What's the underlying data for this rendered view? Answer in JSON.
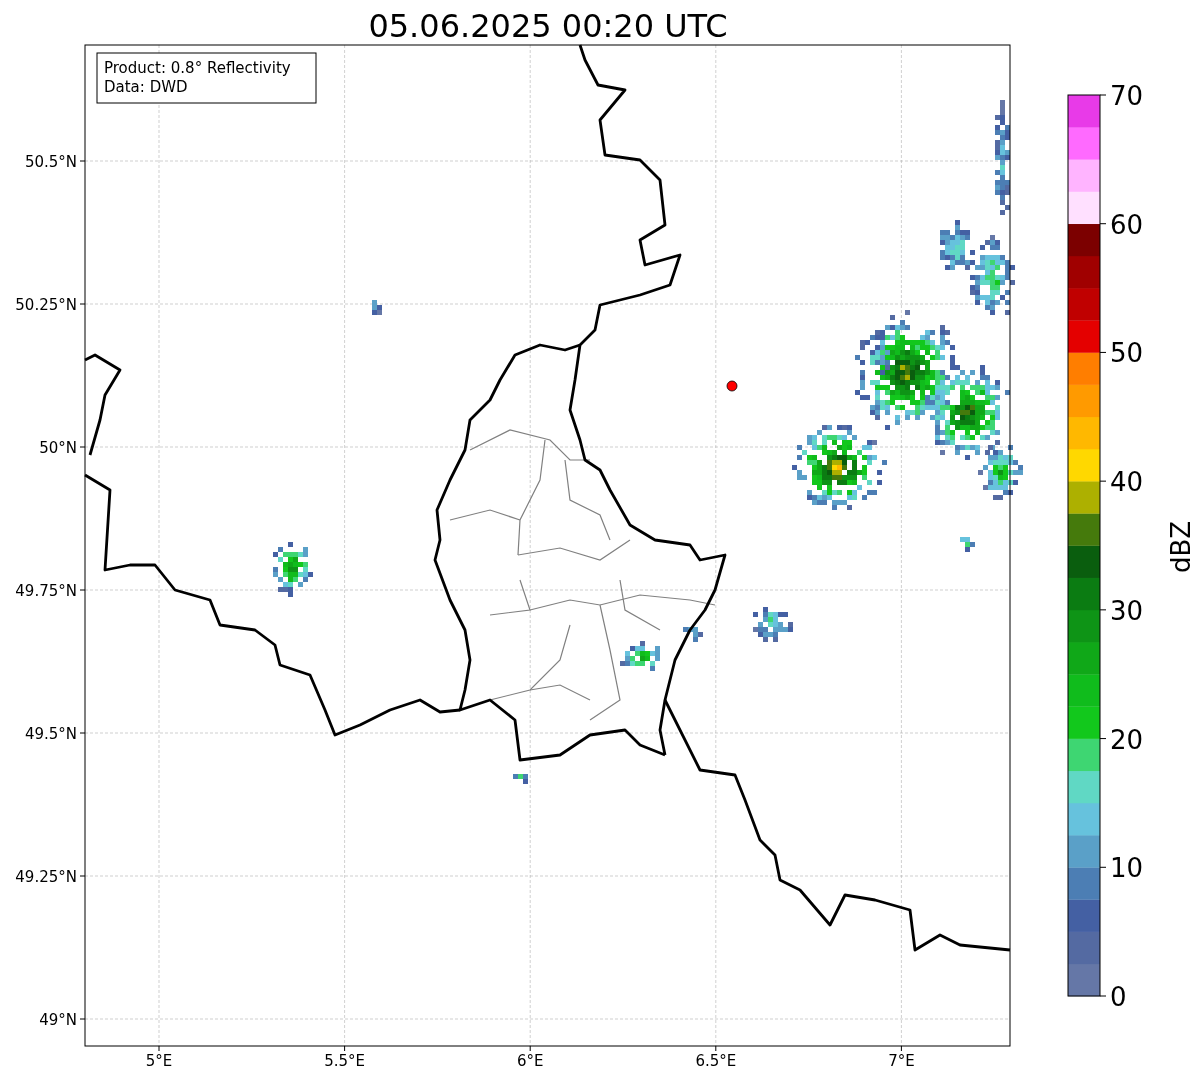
{
  "title": "05.06.2025 00:20 UTC",
  "info_box": [
    "Product: 0.8° Reflectivity",
    "Data: DWD"
  ],
  "map": {
    "x_ticks": [
      "5°E",
      "5.5°E",
      "6°E",
      "6.5°E",
      "7°E"
    ],
    "y_ticks": [
      "50.5°N",
      "50.25°N",
      "50°N",
      "49.75°N",
      "49.5°N",
      "49.25°N",
      "49°N"
    ]
  },
  "colorbar": {
    "label": "dBZ",
    "ticks": [
      "70",
      "60",
      "50",
      "40",
      "30",
      "20",
      "10",
      "0"
    ],
    "bins": [
      {
        "color": "#6577a7"
      },
      {
        "color": "#546aa2"
      },
      {
        "color": "#4460a3"
      },
      {
        "color": "#4c7eb4"
      },
      {
        "color": "#5aa0c8"
      },
      {
        "color": "#66c2dd"
      },
      {
        "color": "#60d8c4"
      },
      {
        "color": "#3ed672"
      },
      {
        "color": "#12c81c"
      },
      {
        "color": "#10bc1c"
      },
      {
        "color": "#10a818"
      },
      {
        "color": "#0e9416"
      },
      {
        "color": "#0b7c12"
      },
      {
        "color": "#0a5e0e"
      },
      {
        "color": "#457a0c"
      },
      {
        "color": "#adb000"
      },
      {
        "color": "#ffd800"
      },
      {
        "color": "#ffb800"
      },
      {
        "color": "#ff9a00"
      },
      {
        "color": "#ff7e00"
      },
      {
        "color": "#e40000"
      },
      {
        "color": "#c00000"
      },
      {
        "color": "#a00000"
      },
      {
        "color": "#7c0000"
      },
      {
        "color": "#ffe0ff"
      },
      {
        "color": "#ffb4ff"
      },
      {
        "color": "#ff6aff"
      },
      {
        "color": "#e83ae8"
      }
    ]
  }
}
